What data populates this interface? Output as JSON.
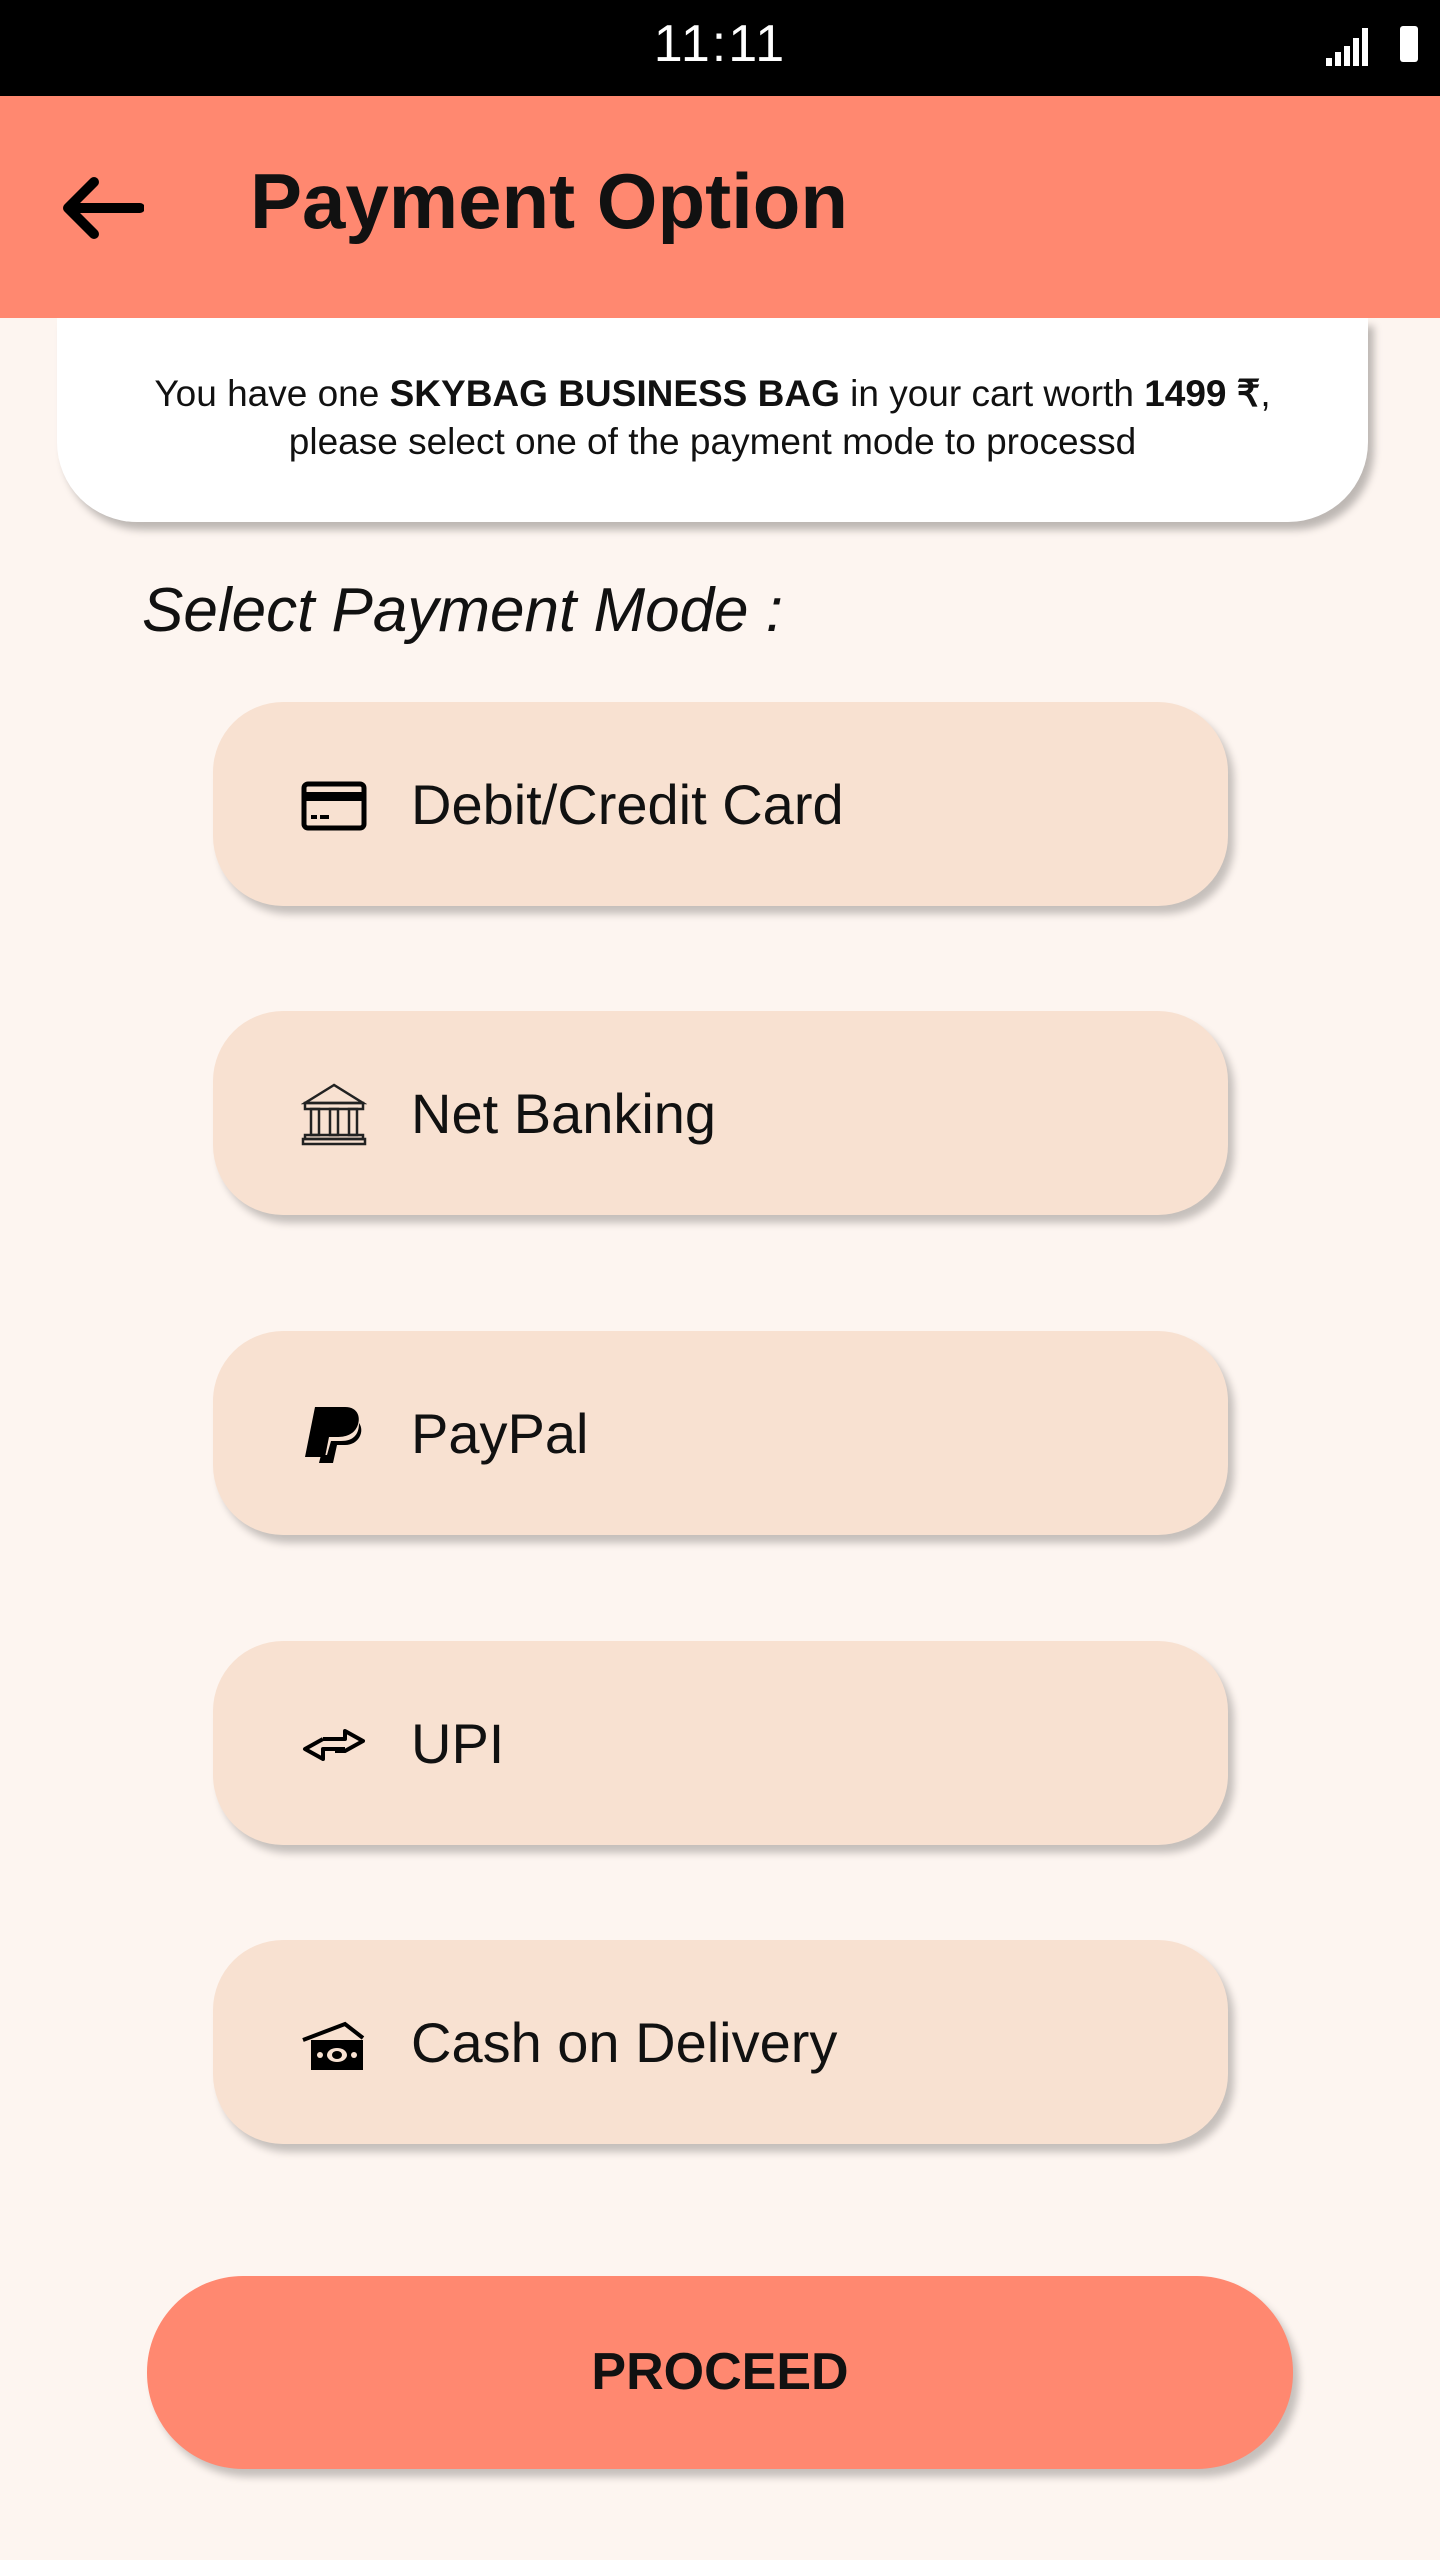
{
  "status_bar": {
    "time": "11:11",
    "icons": [
      "signal-icon",
      "battery-icon"
    ]
  },
  "header": {
    "title": "Payment Option",
    "back_icon": "arrow-left-icon"
  },
  "info": {
    "prefix": "You have one ",
    "product": "SKYBAG BUSINESS BAG",
    "middle": " in your cart worth ",
    "price": "1499 ₹",
    "suffix": ",",
    "line2": "please select one of the payment mode to processd"
  },
  "section_title": "Select Payment Mode :",
  "options": [
    {
      "label": "Debit/Credit Card",
      "icon": "credit-card-icon"
    },
    {
      "label": "Net Banking",
      "icon": "bank-icon"
    },
    {
      "label": "PayPal",
      "icon": "paypal-icon"
    },
    {
      "label": "UPI",
      "icon": "transfer-arrows-icon"
    },
    {
      "label": "Cash on Delivery",
      "icon": "cash-icon"
    }
  ],
  "proceed_label": "PROCEED",
  "colors": {
    "header": "#ff8870",
    "background": "#fdf5f0",
    "option": "#f8e1d1",
    "button": "#ff8870"
  }
}
